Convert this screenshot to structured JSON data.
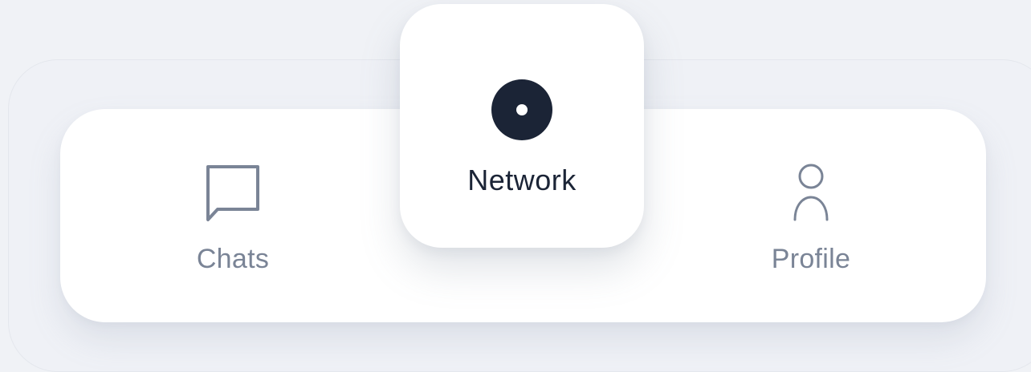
{
  "nav": {
    "items": [
      {
        "label": "Chats",
        "icon": "chat-bubble-icon",
        "active": false
      },
      {
        "label": "Network",
        "icon": "network-dot-icon",
        "active": true
      },
      {
        "label": "Profile",
        "icon": "person-icon",
        "active": false
      }
    ]
  },
  "colors": {
    "background": "#f0f2f6",
    "card": "#ffffff",
    "active_text": "#1b2436",
    "inactive_text": "#7a8496"
  }
}
